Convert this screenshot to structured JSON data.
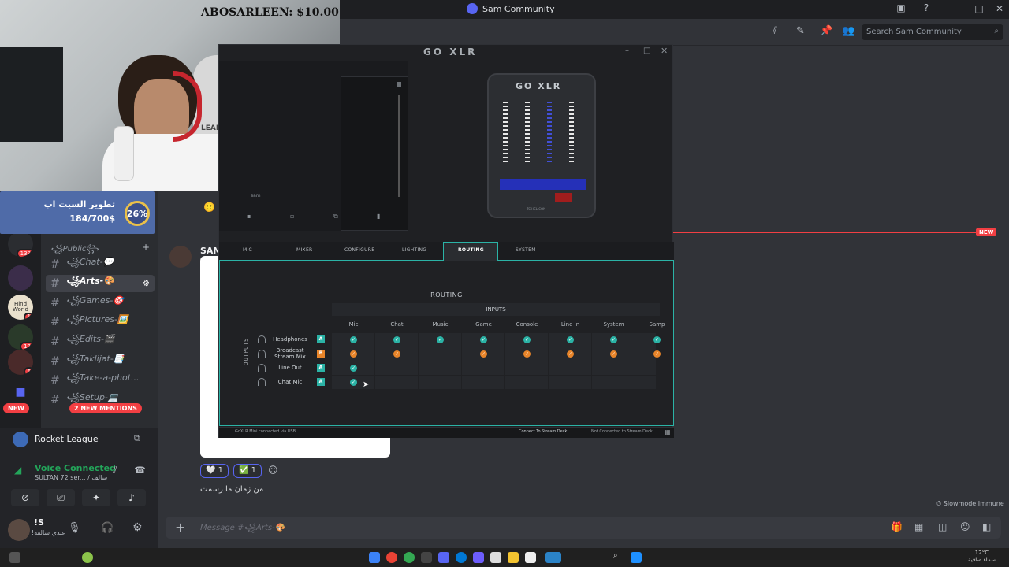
{
  "window": {
    "title": "Sam Community",
    "search_placeholder": "Search Sam Community"
  },
  "webcam": {
    "donation_text": "ABOSARLEEN: $10.00",
    "jersey_text": "LEADER"
  },
  "donation_widget": {
    "title": "تطوير السيت اب",
    "progress_text": "184/700$",
    "percent": "26%",
    "progress_fraction": 0.26
  },
  "server_rail": {
    "badges": [
      "139",
      "1",
      "12",
      "6"
    ],
    "server_label": "Hind World"
  },
  "channels": {
    "category": "꧁Public꧂",
    "items": [
      {
        "label": "꧁Chat-💬"
      },
      {
        "label": "꧁Arts-🎨",
        "active": true
      },
      {
        "label": "꧁Games-🎯"
      },
      {
        "label": "꧁Pictures-🖼️"
      },
      {
        "label": "꧁Edits-🎬"
      },
      {
        "label": "꧁Taklijat-📑"
      },
      {
        "label": "꧁Take-a-phot..."
      },
      {
        "label": "꧁Setup-💻"
      }
    ],
    "new_pill": "NEW",
    "mentions_pill": "2 NEW MENTIONS"
  },
  "activity": {
    "game_name": "Rocket League",
    "voice_status": "Voice Connected",
    "voice_channel": "SULTAN 72 ser... / سالف"
  },
  "user": {
    "name": "!S",
    "status": "!عندي سالفة"
  },
  "chat": {
    "author_partial": "SAM",
    "new_label": "NEW",
    "reactions": [
      {
        "emoji": "🤍",
        "count": "1"
      },
      {
        "emoji": "✅",
        "count": "1"
      }
    ],
    "message_text": "من زمان ما رسمت",
    "slowmode": "Slowmode Immune",
    "composer_placeholder": "Message #꧁Arts-🎨"
  },
  "goxlr": {
    "title": "GO XLR",
    "device_brand": "GO XLR",
    "device_footer": "TC·HELICON",
    "left_panel_label": "sam",
    "tabs": [
      "MIC",
      "MIXER",
      "CONFIGURE",
      "LIGHTING",
      "ROUTING",
      "SYSTEM"
    ],
    "active_tab": "ROUTING",
    "routing_title": "ROUTING",
    "inputs_label": "INPUTS",
    "outputs_label": "OUTPUTS",
    "columns": [
      "Mic",
      "Chat",
      "Music",
      "Game",
      "Console",
      "Line In",
      "System",
      "Samp"
    ],
    "rows": [
      {
        "label": "Headphones",
        "tag": "A",
        "tag_color": "#2bb3a6",
        "check_color": "#2bb3a6",
        "routes": [
          1,
          1,
          1,
          1,
          1,
          1,
          1,
          1
        ]
      },
      {
        "label": "Broadcast Stream Mix",
        "tag": "B",
        "tag_color": "#e8852a",
        "check_color": "#e8852a",
        "routes": [
          1,
          1,
          0,
          1,
          1,
          1,
          1,
          1
        ]
      },
      {
        "label": "Line Out",
        "tag": "A",
        "tag_color": "#2bb3a6",
        "check_color": "#2bb3a6",
        "routes": [
          1,
          0,
          0,
          0,
          0,
          0,
          0,
          0
        ]
      },
      {
        "label": "Chat Mic",
        "tag": "A",
        "tag_color": "#2bb3a6",
        "check_color": "#2bb3a6",
        "routes": [
          1,
          0,
          0,
          0,
          0,
          0,
          0,
          0
        ]
      }
    ],
    "status_left": "GoXLR Mini connected via USB",
    "status_mid": "Connect To Stream Deck",
    "status_right": "Not Connected to Stream Deck"
  },
  "taskbar": {
    "clock_time": "12°C",
    "clock_date": "سماء صافية"
  },
  "colors": {
    "discord_bg": "#313338",
    "accent_red": "#f23f43",
    "goxlr_teal": "#2bb3a6",
    "goxlr_orange": "#e8852a",
    "voice_green": "#23a55a"
  }
}
